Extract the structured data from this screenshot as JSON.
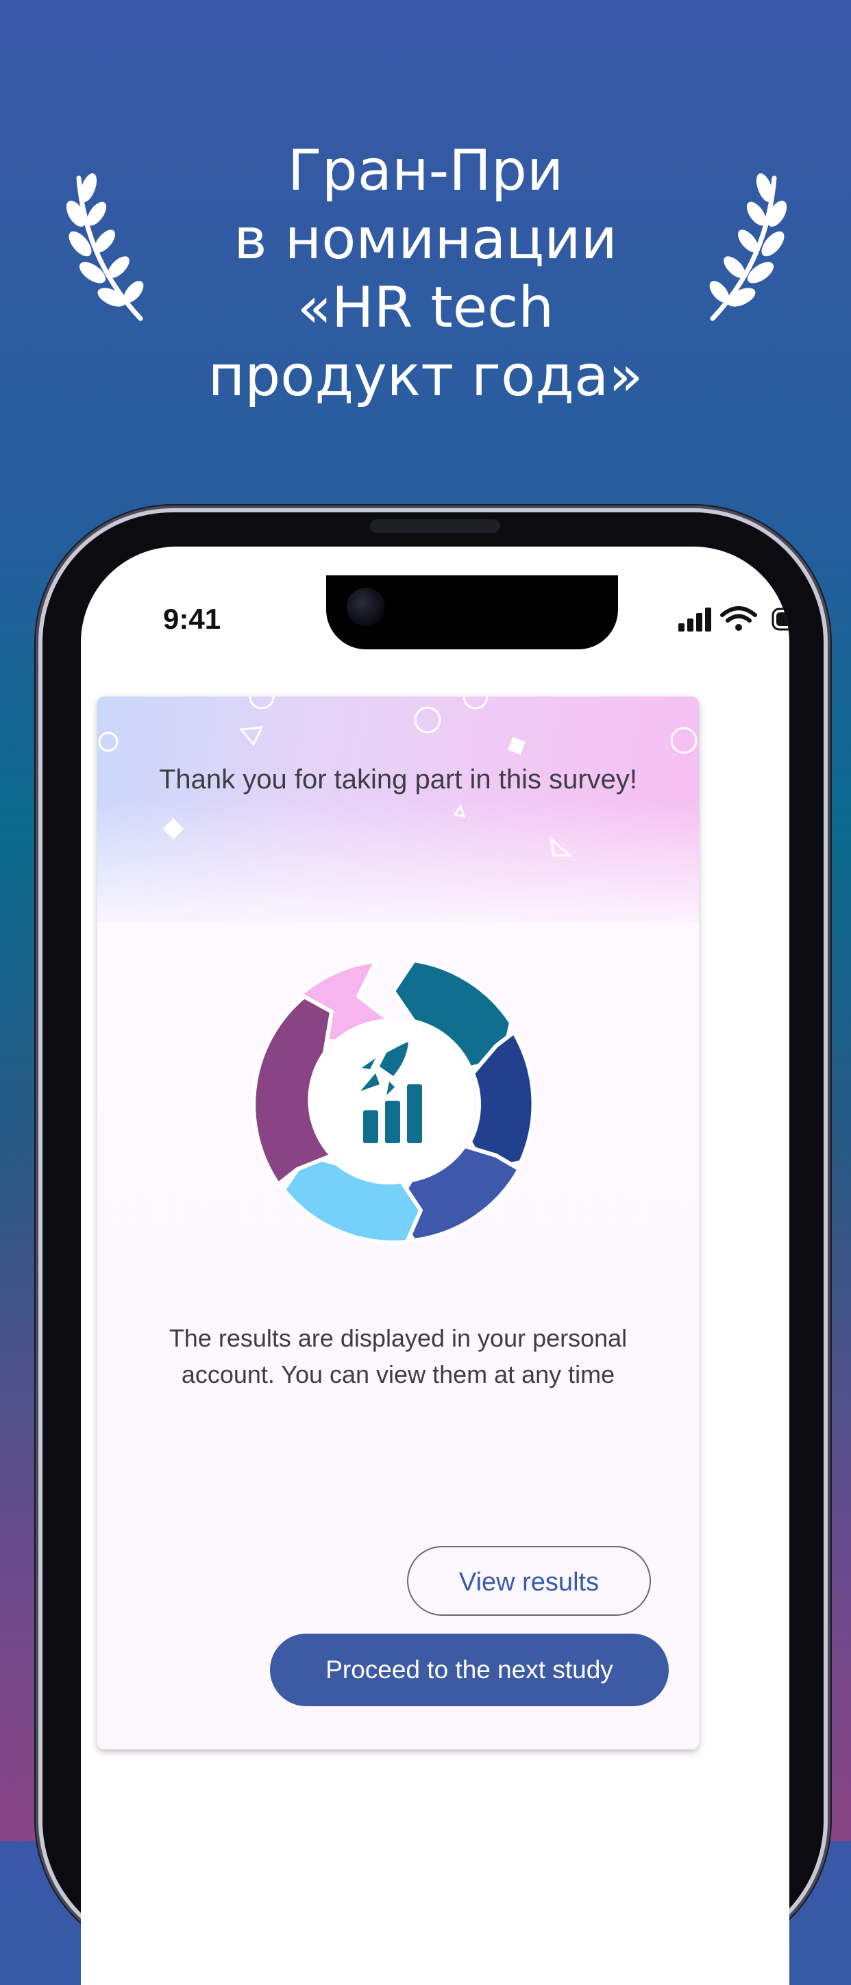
{
  "hero": {
    "title": "Гран-При\nв номинации\n«HR tech\nпродукт года»"
  },
  "status_bar": {
    "time": "9:41"
  },
  "survey_card": {
    "thank_you": "Thank you for taking part in this survey!",
    "results_message": "The results are displayed in your personal account. You can view them at any time",
    "view_results_label": "View results",
    "next_study_label": "Proceed to the next study"
  },
  "colors": {
    "primary_button": "#3d5aa5",
    "cycle_pink": "#f7b5ef",
    "cycle_teal": "#106f8e",
    "cycle_navy": "#23408e",
    "cycle_blue": "#3e58ac",
    "cycle_lightblue": "#75d0fa",
    "cycle_purple": "#8a4384"
  }
}
